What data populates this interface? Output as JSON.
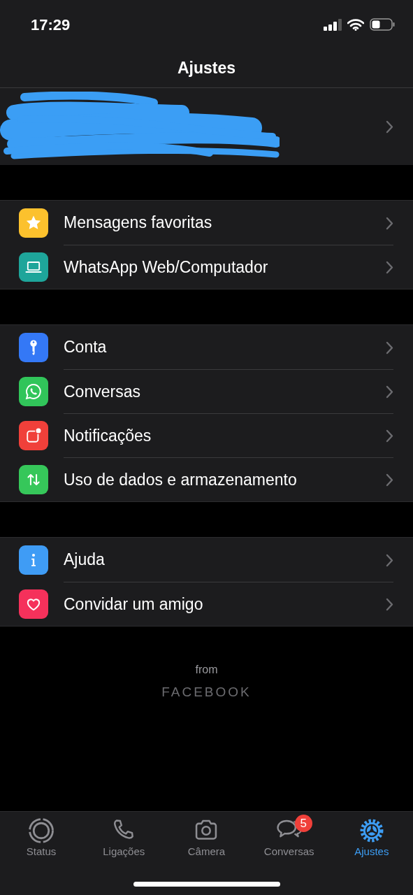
{
  "status_bar": {
    "time": "17:29"
  },
  "header": {
    "title": "Ajustes"
  },
  "profile": {
    "redacted": true
  },
  "groups": [
    {
      "items": [
        {
          "label": "Mensagens favoritas",
          "kind": "star",
          "color": "#fcc12d"
        },
        {
          "label": "WhatsApp Web/Computador",
          "kind": "laptop",
          "color": "#1ea59a"
        }
      ]
    },
    {
      "items": [
        {
          "label": "Conta",
          "kind": "key",
          "color": "#3478f6"
        },
        {
          "label": "Conversas",
          "kind": "whatsapp",
          "color": "#31c55a"
        },
        {
          "label": "Notificações",
          "kind": "notification",
          "color": "#f0403a"
        },
        {
          "label": "Uso de dados e armazenamento",
          "kind": "arrows",
          "color": "#36c75a"
        }
      ]
    },
    {
      "items": [
        {
          "label": "Ajuda",
          "kind": "info",
          "color": "#3f9cf5"
        },
        {
          "label": "Convidar um amigo",
          "kind": "heart",
          "color": "#f5315b"
        }
      ]
    }
  ],
  "footer": {
    "from": "from",
    "brand": "FACEBOOK"
  },
  "tabs": [
    {
      "label": "Status",
      "kind": "status",
      "selected": false
    },
    {
      "label": "Ligações",
      "kind": "phone",
      "selected": false
    },
    {
      "label": "Câmera",
      "kind": "camera",
      "selected": false
    },
    {
      "label": "Conversas",
      "kind": "chat",
      "selected": false,
      "badge": "5"
    },
    {
      "label": "Ajustes",
      "kind": "gear",
      "selected": true
    }
  ]
}
